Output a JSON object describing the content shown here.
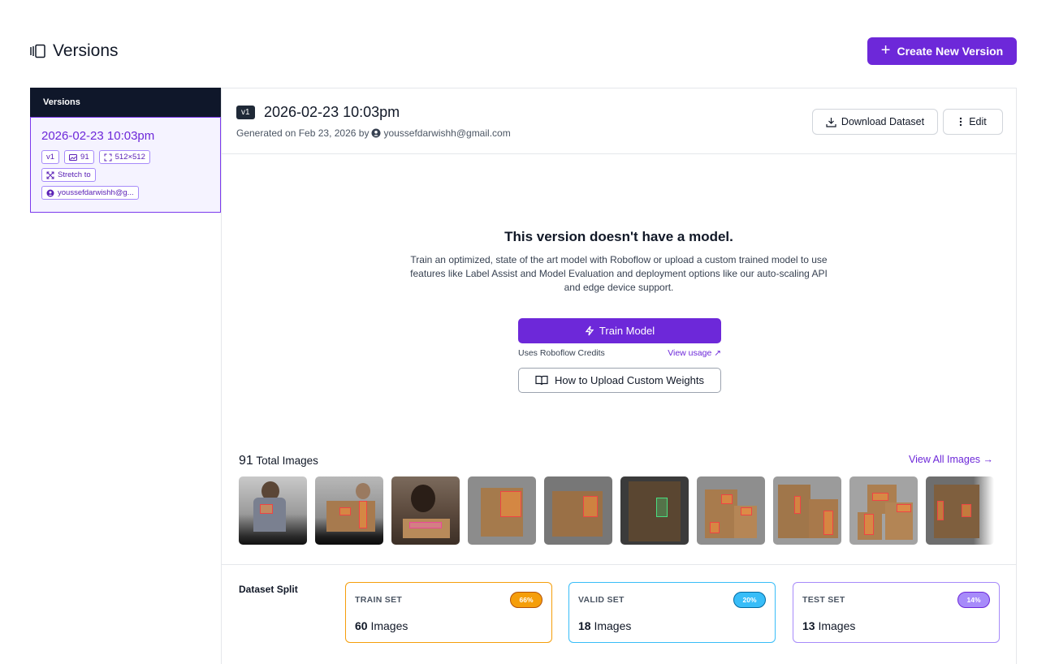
{
  "page": {
    "title": "Versions",
    "create_button": "Create New Version"
  },
  "sidebar": {
    "header": "Versions",
    "version_card": {
      "date": "2026-02-23 10:03pm",
      "tag_version": "v1",
      "tag_images": "91",
      "tag_size": "512×512",
      "tag_resize": "Stretch to",
      "tag_user": "youssefdarwishh@g..."
    }
  },
  "version": {
    "badge": "v1",
    "title": "2026-02-23 10:03pm",
    "generated_prefix": "Generated on Feb 23, 2026 by",
    "user": "youssefdarwishh@gmail.com",
    "download_button": "Download Dataset",
    "edit_button": "Edit"
  },
  "no_model": {
    "title": "This version doesn't have a model.",
    "description": "Train an optimized, state of the art model with Roboflow or upload a custom trained model to use features like Label Assist and Model Evaluation and deployment options like our auto-scaling API and edge device support.",
    "train_button": "Train Model",
    "credits_text": "Uses Roboflow Credits",
    "view_usage": "View usage ↗",
    "upload_button": "How to Upload Custom Weights"
  },
  "images": {
    "total_count": "91",
    "total_label": "Total Images",
    "view_all": "View All Images →"
  },
  "split": {
    "label": "Dataset Split",
    "sets": [
      {
        "name": "TRAIN SET",
        "percent": "66%",
        "count": "60",
        "unit": "Images",
        "color": "#f59e0b"
      },
      {
        "name": "VALID SET",
        "percent": "20%",
        "count": "18",
        "unit": "Images",
        "color": "#38bdf8"
      },
      {
        "name": "TEST SET",
        "percent": "14%",
        "count": "13",
        "unit": "Images",
        "color": "#a78bfa"
      }
    ]
  }
}
